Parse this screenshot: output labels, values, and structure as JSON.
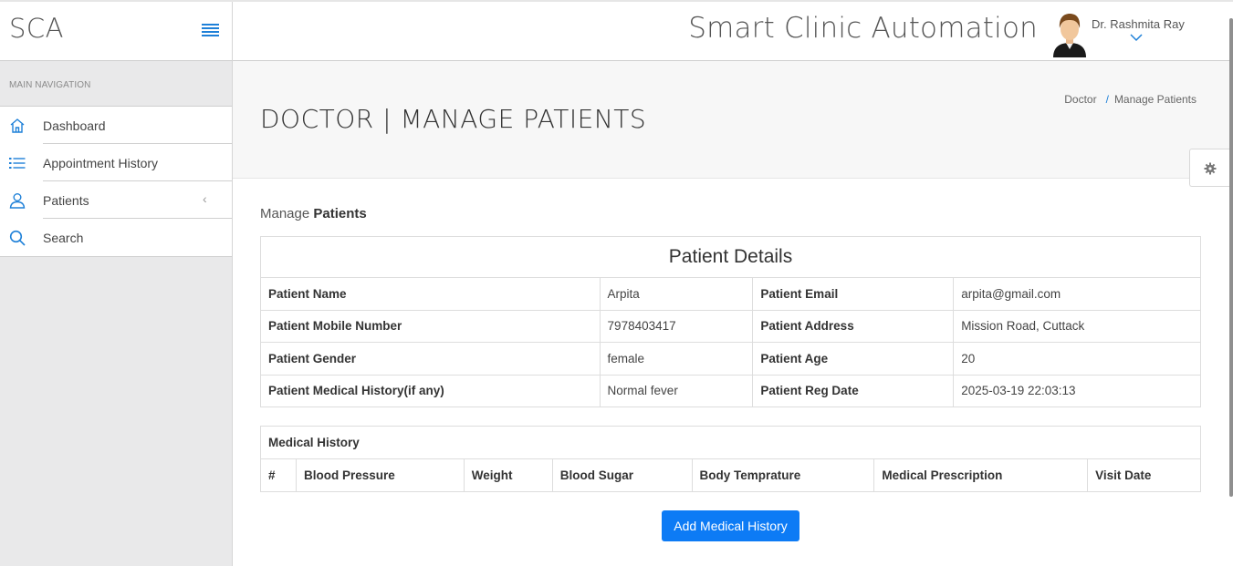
{
  "brand": {
    "name": "SCA"
  },
  "header": {
    "title": "Smart Clinic Automation",
    "user_name": "Dr. Rashmita Ray"
  },
  "sidebar": {
    "section_label": "MAIN NAVIGATION",
    "items": [
      {
        "label": "Dashboard",
        "icon": "home-icon"
      },
      {
        "label": "Appointment History",
        "icon": "list-icon"
      },
      {
        "label": "Patients",
        "icon": "user-icon",
        "has_submenu": true
      },
      {
        "label": "Search",
        "icon": "search-icon"
      }
    ]
  },
  "page": {
    "title": "DOCTOR | MANAGE PATIENTS",
    "breadcrumb": [
      "Doctor",
      "Manage Patients"
    ],
    "section_prefix": "Manage",
    "section_strong": "Patients"
  },
  "patient_details": {
    "heading": "Patient Details",
    "rows": [
      {
        "k1": "Patient Name",
        "v1": "Arpita",
        "k2": "Patient Email",
        "v2": "arpita@gmail.com"
      },
      {
        "k1": "Patient Mobile Number",
        "v1": "7978403417",
        "k2": "Patient Address",
        "v2": "Mission Road, Cuttack"
      },
      {
        "k1": "Patient Gender",
        "v1": "female",
        "k2": "Patient Age",
        "v2": "20"
      },
      {
        "k1": "Patient Medical History(if any)",
        "v1": "Normal fever",
        "k2": "Patient Reg Date",
        "v2": "2025-03-19 22:03:13"
      }
    ]
  },
  "medical_history": {
    "caption": "Medical History",
    "columns": [
      "#",
      "Blood Pressure",
      "Weight",
      "Blood Sugar",
      "Body Temprature",
      "Medical Prescription",
      "Visit Date"
    ]
  },
  "actions": {
    "add_label": "Add Medical History"
  },
  "colors": {
    "accent": "#1e80d8",
    "button": "#0d7bf5"
  }
}
